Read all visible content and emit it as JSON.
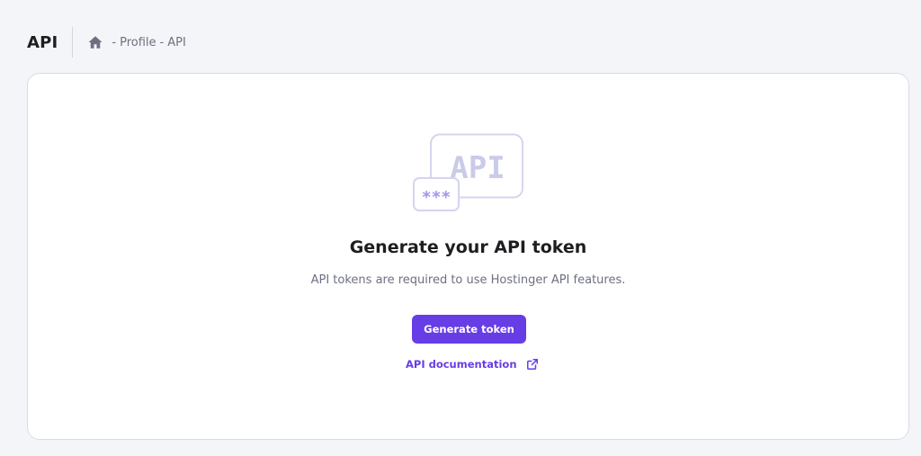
{
  "header": {
    "title": "API",
    "breadcrumb": {
      "home_icon": "home-icon",
      "separator": "-",
      "items": [
        "Profile",
        "API"
      ]
    }
  },
  "card": {
    "illustration": {
      "icon": "api-key-illustration",
      "api_text": "API",
      "masked_text": "***"
    },
    "title": "Generate your API token",
    "description": "API tokens are required to use Hostinger API features.",
    "generate_button_label": "Generate token",
    "docs_link_label": "API documentation",
    "docs_link_icon": "external-link-icon"
  },
  "colors": {
    "accent": "#673de6",
    "background": "#f4f5f8",
    "card": "#ffffff",
    "illustration_stroke": "#d4d5ee",
    "illustration_text": "#c9cbe8",
    "masked_text": "#a593f0"
  }
}
